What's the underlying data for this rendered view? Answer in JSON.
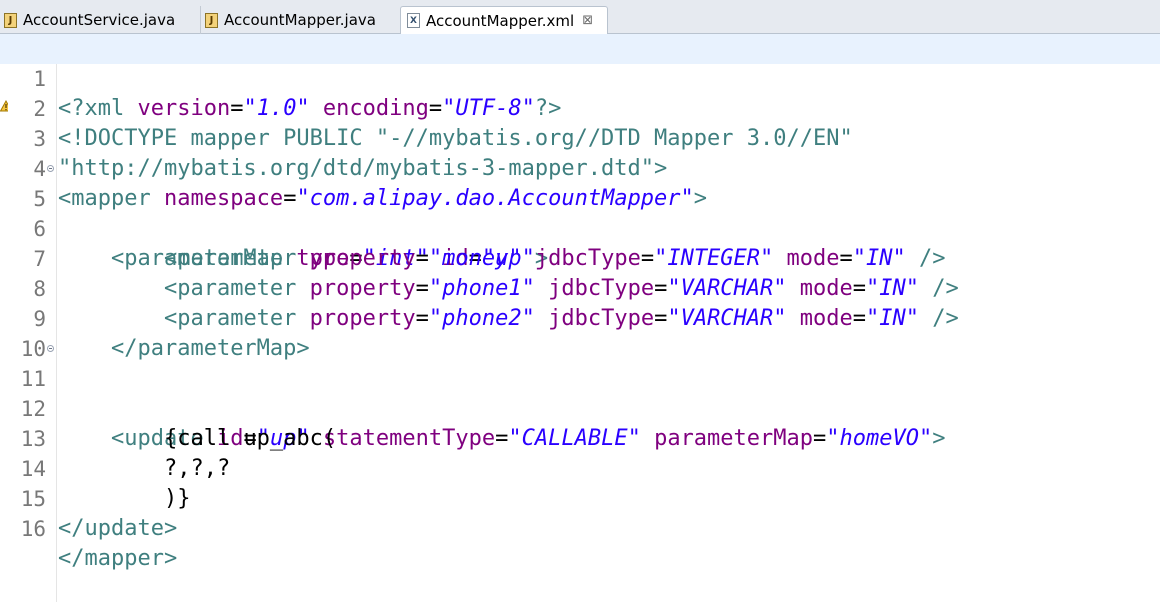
{
  "tabs": [
    {
      "label": "AccountService.java",
      "icon": "java-file-icon"
    },
    {
      "label": "AccountMapper.java",
      "icon": "java-file-icon"
    },
    {
      "label": "AccountMapper.xml",
      "icon": "xml-file-icon",
      "active": true,
      "close": "⊠"
    }
  ],
  "editor": {
    "line_numbers": [
      "1",
      "2",
      "3",
      "4",
      "5",
      "6",
      "7",
      "8",
      "9",
      "10",
      "11",
      "12",
      "13",
      "14",
      "15",
      "16"
    ],
    "code": {
      "l1": {
        "a": "<?xml ",
        "b": "version",
        "c": "=",
        "d": "\"1.0\"",
        "e": " encoding",
        "f": "=",
        "g": "\"UTF-8\"",
        "h": "?>"
      },
      "l2": {
        "a": "<!DOCTYPE mapper PUBLIC ",
        "b": "\"-//mybatis.org//DTD Mapper 3.0//EN\""
      },
      "l3": {
        "a": "\"http://mybatis.org/dtd/mybatis-3-mapper.dtd\"",
        "b": ">"
      },
      "l4": {
        "a": "<mapper ",
        "b": "namespace",
        "c": "=",
        "d": "\"com.alipay.dao.AccountMapper\"",
        "e": ">"
      },
      "l5": {
        "indent": "    ",
        "a": "<parameterMap ",
        "b": "type",
        "c": "=",
        "d": "\"int\"",
        "e": " id",
        "f": "=",
        "g": "\"up\"",
        "h": ">"
      },
      "l6": {
        "indent": "        ",
        "a": "<parameter ",
        "b": "property",
        "c": "=",
        "d": "\"money\"",
        "e": " jdbcType",
        "f": "=",
        "g": "\"INTEGER\"",
        "h": " mode",
        "i": "=",
        "j": "\"IN\"",
        "k": " />"
      },
      "l7": {
        "indent": "        ",
        "a": "<parameter ",
        "b": "property",
        "c": "=",
        "d": "\"phone1\"",
        "e": " jdbcType",
        "f": "=",
        "g": "\"VARCHAR\"",
        "h": " mode",
        "i": "=",
        "j": "\"IN\"",
        "k": " />"
      },
      "l8": {
        "indent": "        ",
        "a": "<parameter ",
        "b": "property",
        "c": "=",
        "d": "\"phone2\"",
        "e": " jdbcType",
        "f": "=",
        "g": "\"VARCHAR\"",
        "h": " mode",
        "i": "=",
        "j": "\"IN\"",
        "k": " />"
      },
      "l9": {
        "indent": "    ",
        "a": "</parameterMap>"
      },
      "l10": {
        "a": ""
      },
      "l11": {
        "indent": "    ",
        "a": "<update ",
        "b": "id",
        "c": "=",
        "d": "\"up\"",
        "e": " statementType",
        "f": "=",
        "g": "\"CALLABLE\"",
        "h": " parameterMap",
        "i": "=",
        "j": "\"homeVO\"",
        "k": ">"
      },
      "l12": {
        "indent": "        ",
        "a": "{call up_abc("
      },
      "l13": {
        "indent": "        ",
        "a": "?,?,?"
      },
      "l14": {
        "indent": "        ",
        "a": ")}"
      },
      "l15": {
        "a": "</update>"
      },
      "l16": {
        "a": "</mapper>"
      }
    }
  },
  "colors": {
    "tag": "#3f7f7f",
    "attribute": "#7f007f",
    "value": "#2a00ff",
    "current_line": "#e8f2fe",
    "line_number": "#787878"
  }
}
